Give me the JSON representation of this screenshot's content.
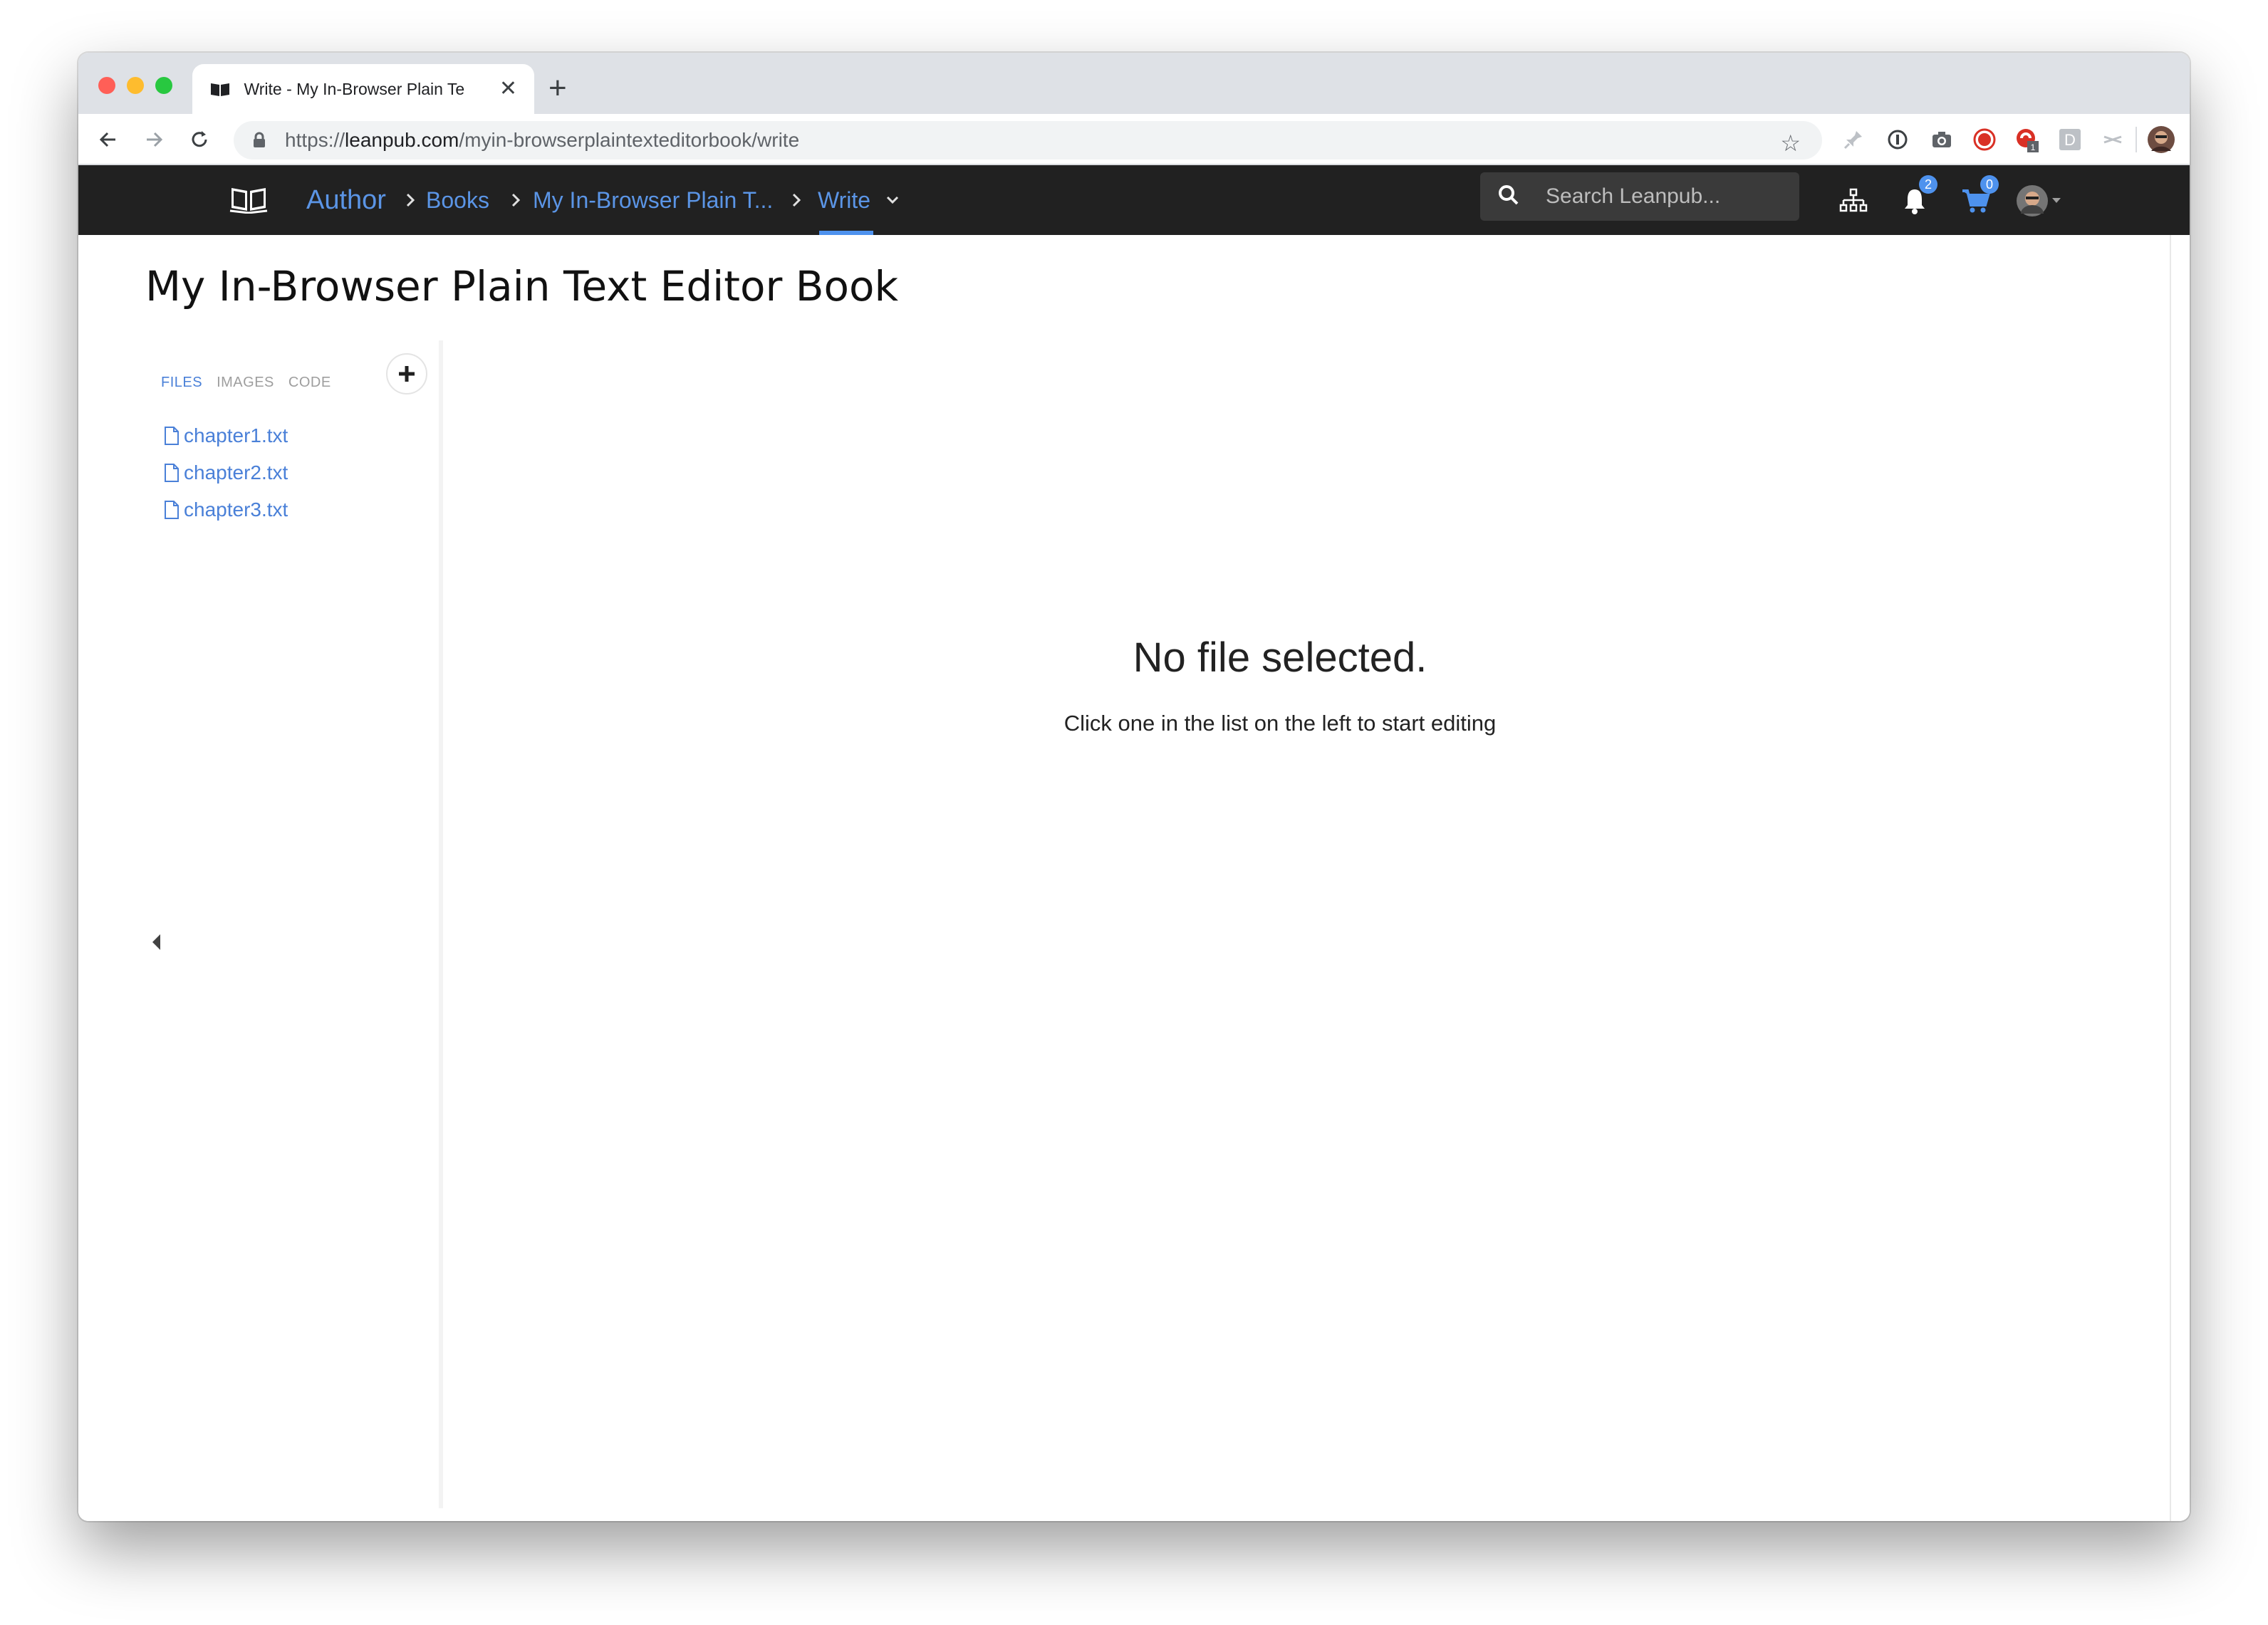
{
  "browser": {
    "tab": {
      "title": "Write - My In-Browser Plain Te",
      "close": "✕"
    },
    "new_tab": "+",
    "url": {
      "scheme": "https://",
      "host": "leanpub.com",
      "path": "/myin-browserplaintexteditorbook/write"
    },
    "extensions": [
      {
        "name": "pin-icon"
      },
      {
        "name": "info-icon"
      },
      {
        "name": "camera-icon"
      },
      {
        "name": "record-icon",
        "color": "#d93025"
      },
      {
        "name": "red-extension-icon",
        "color": "#d93025",
        "badge": "1"
      },
      {
        "name": "d-extension-icon",
        "label": "D"
      },
      {
        "name": "scissors-icon"
      }
    ]
  },
  "nav": {
    "author": "Author",
    "books": "Books",
    "book_name": "My In-Browser Plain T...",
    "write": "Write",
    "search_placeholder": "Search Leanpub...",
    "notifications_count": "2",
    "cart_count": "0"
  },
  "page": {
    "title": "My In-Browser Plain Text Editor Book"
  },
  "sidebar": {
    "tabs": [
      {
        "label": "FILES",
        "active": true
      },
      {
        "label": "IMAGES",
        "active": false
      },
      {
        "label": "CODE",
        "active": false
      }
    ],
    "add": "+",
    "files": [
      {
        "name": "chapter1.txt"
      },
      {
        "name": "chapter2.txt"
      },
      {
        "name": "chapter3.txt"
      }
    ]
  },
  "editor": {
    "empty_title": "No file selected.",
    "empty_message": "Click one in the list on the left to start editing"
  },
  "colors": {
    "accent": "#4a80d8",
    "nav_bg": "#212121",
    "link": "#5b95e6"
  }
}
